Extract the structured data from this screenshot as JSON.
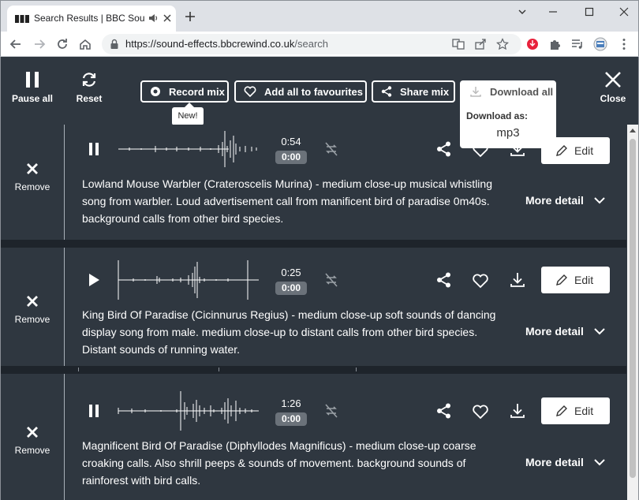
{
  "browser": {
    "tab_title": "Search Results | BBC Sound",
    "url_host": "https://sound-effects.bbcrewind.co.uk",
    "url_path": "/search"
  },
  "controls": {
    "pause_all": "Pause all",
    "reset": "Reset",
    "record_mix": "Record mix",
    "new_badge": "New!",
    "add_all_favourites": "Add all to favourites",
    "share_mix": "Share mix",
    "download_all": "Download all",
    "download_as_label": "Download as:",
    "download_format": "mp3",
    "close": "Close"
  },
  "sounds": [
    {
      "state": "playing",
      "duration": "0:54",
      "position": "0:00",
      "description": "Lowland Mouse Warbler (Crateroscelis Murina) - medium close-up musical whistling song from warbler. Loud advertisement call from manificent bird of paradise 0m40s. background calls from other bird species.",
      "remove_label": "Remove",
      "edit_label": "Edit",
      "more_label": "More detail"
    },
    {
      "state": "paused",
      "duration": "0:25",
      "position": "0:00",
      "description": "King Bird Of Paradise (Cicinnurus Regius) - medium close-up soft sounds of dancing display song from male. medium close-up to distant calls from other bird species. Distant sounds of running water.",
      "remove_label": "Remove",
      "edit_label": "Edit",
      "more_label": "More detail"
    },
    {
      "state": "playing",
      "duration": "1:26",
      "position": "0:00",
      "description": "Magnificent Bird Of Paradise (Diphyllodes Magnificus) - medium close-up coarse croaking calls. Also shrill peeps & sounds of movement. background sounds of rainforest with bird calls.",
      "remove_label": "Remove",
      "edit_label": "Edit",
      "more_label": "More detail"
    }
  ]
}
